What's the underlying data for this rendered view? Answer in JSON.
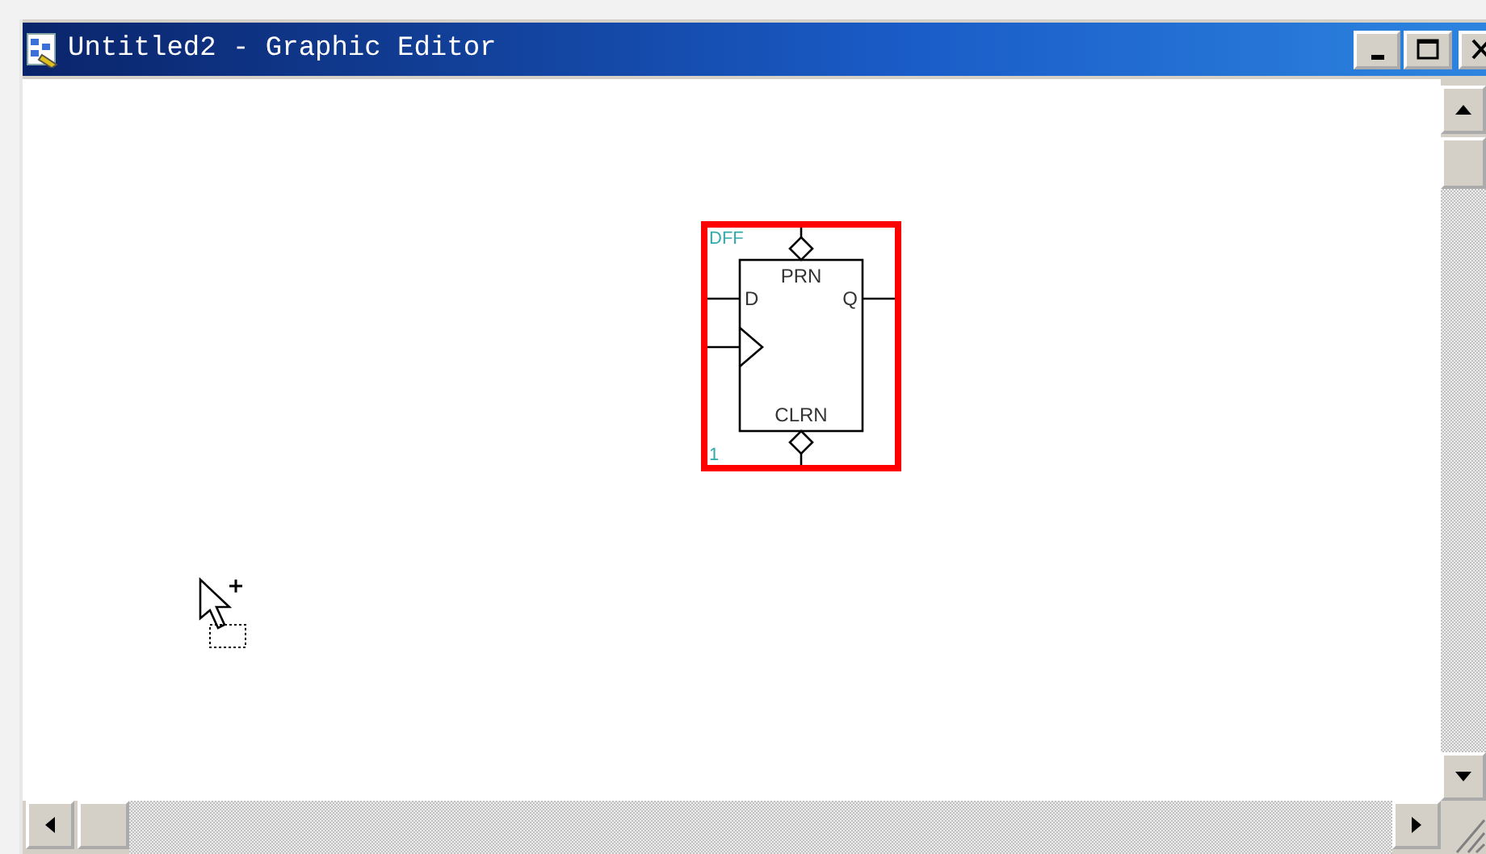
{
  "window": {
    "title": "Untitled2 - Graphic Editor"
  },
  "symbol": {
    "name": "DFF",
    "instance": "1",
    "selected": true,
    "pins": [
      {
        "label": "PRN",
        "kind": "bubble-top"
      },
      {
        "label": "D",
        "kind": "input"
      },
      {
        "label": "Q",
        "kind": "output"
      },
      {
        "label": "CLRN",
        "kind": "bubble-bottom"
      }
    ]
  }
}
